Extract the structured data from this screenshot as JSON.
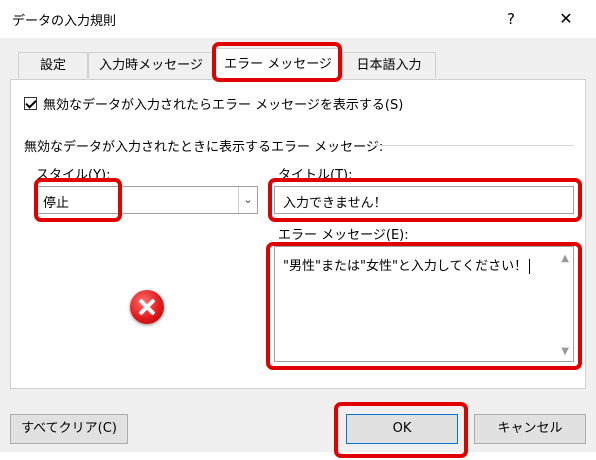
{
  "window": {
    "title": "データの入力規則",
    "help_label": "?",
    "close_label": "✕"
  },
  "tabs": [
    {
      "label": "設定",
      "active": false
    },
    {
      "label": "入力時メッセージ",
      "active": false
    },
    {
      "label": "エラー メッセージ",
      "active": true
    },
    {
      "label": "日本語入力",
      "active": false
    }
  ],
  "error_tab": {
    "show_alert_checkbox": {
      "label": "無効なデータが入力されたらエラー メッセージを表示する(S)",
      "checked": true
    },
    "group_label": "無効なデータが入力されたときに表示するエラー メッセージ:",
    "style_label": "スタイル(Y):",
    "style_value": "停止",
    "style_icon": "error-stop-icon",
    "title_label": "タイトル(T):",
    "title_value": "入力できません！",
    "message_label": "エラー メッセージ(E):",
    "message_value": "\"男性\"または\"女性\"と入力してください！"
  },
  "buttons": {
    "clear_all": "すべてクリア(C)",
    "ok": "OK",
    "cancel": "キャンセル"
  },
  "colors": {
    "highlight": "#e00000",
    "dialog_bg": "#f0f0f0",
    "default_button_border": "#0078d7"
  }
}
